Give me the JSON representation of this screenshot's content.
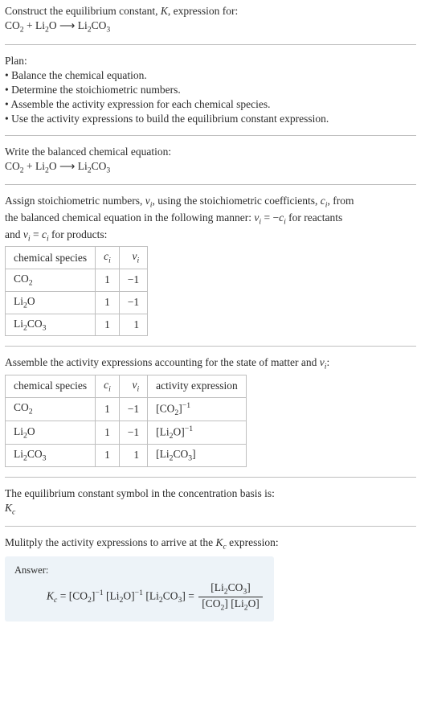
{
  "intro": {
    "line1": "Construct the equilibrium constant, ",
    "K": "K",
    "line1b": ", expression for:",
    "eq1_lhs": "CO",
    "eq1_lhs_sub": "2",
    "plus": " + Li",
    "plus_sub": "2",
    "O": "O ",
    "arrow": "⟶",
    "rhs": " Li",
    "rhs_sub": "2",
    "rhs2": "CO",
    "rhs2_sub": "3"
  },
  "plan": {
    "title": "Plan:",
    "b1": "• Balance the chemical equation.",
    "b2": "• Determine the stoichiometric numbers.",
    "b3": "• Assemble the activity expression for each chemical species.",
    "b4": "• Use the activity expressions to build the equilibrium constant expression."
  },
  "balanced": {
    "title": "Write the balanced chemical equation:"
  },
  "assign": {
    "l1a": "Assign stoichiometric numbers, ",
    "nu": "ν",
    "i": "i",
    "l1b": ", using the stoichiometric coefficients, ",
    "c": "c",
    "l1c": ", from",
    "l2a": "the balanced chemical equation in the following manner: ",
    "eqA": " = −",
    "l2b": " for reactants",
    "l3a": "and ",
    "eqB": " = ",
    "l3b": " for products:"
  },
  "table1": {
    "h1": "chemical species",
    "h2": "c",
    "h2sub": "i",
    "h3": "ν",
    "h3sub": "i",
    "rows": [
      {
        "sp_a": "CO",
        "sp_as": "2",
        "ci": "1",
        "vi": "−1"
      },
      {
        "sp_a": "Li",
        "sp_as": "2",
        "sp_b": "O",
        "ci": "1",
        "vi": "−1"
      },
      {
        "sp_a": "Li",
        "sp_as": "2",
        "sp_b": "CO",
        "sp_bs": "3",
        "ci": "1",
        "vi": "1"
      }
    ]
  },
  "assemble": {
    "line": "Assemble the activity expressions accounting for the state of matter and "
  },
  "table2": {
    "h4": "activity expression",
    "rows": [
      {
        "ae_a": "[CO",
        "ae_as": "2",
        "ae_b": "]",
        "exp": "−1"
      },
      {
        "ae_a": "[Li",
        "ae_as": "2",
        "ae_b": "O]",
        "exp": "−1"
      },
      {
        "ae_a": "[Li",
        "ae_as": "2",
        "ae_b": "CO",
        "ae_bs": "3",
        "ae_c": "]"
      }
    ]
  },
  "symb": {
    "line": "The equilibrium constant symbol in the concentration basis is:",
    "K": "K",
    "c": "c"
  },
  "mult": {
    "line": "Mulitply the activity expressions to arrive at the ",
    "tail": " expression:"
  },
  "answer": {
    "label": "Answer:",
    "eq_pre": " = ",
    "p1a": "[CO",
    "p1as": "2",
    "p1b": "]",
    "p1e": "−1",
    "p2a": " [Li",
    "p2as": "2",
    "p2b": "O]",
    "p2e": "−1",
    "p3a": " [Li",
    "p3as": "2",
    "p3b": "CO",
    "p3bs": "3",
    "p3c": "] = ",
    "num_a": "[Li",
    "num_as": "2",
    "num_b": "CO",
    "num_bs": "3",
    "num_c": "]",
    "den_a": "[CO",
    "den_as": "2",
    "den_b": "] [Li",
    "den_bs": "2",
    "den_c": "O]"
  }
}
